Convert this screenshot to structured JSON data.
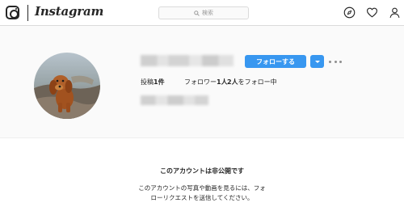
{
  "header": {
    "brand": "Instagram",
    "search_placeholder": "検索",
    "icons": [
      "instagram-glyph-icon",
      "search-icon",
      "explore-compass-icon",
      "heart-icon",
      "profile-icon"
    ]
  },
  "profile": {
    "follow_label": "フォローする",
    "stats": {
      "posts_label": "投稿",
      "posts_count": "1件",
      "followers_label": "フォロワー",
      "followers_count": "1人",
      "following_count": "2人",
      "following_label": "をフォロー中"
    }
  },
  "private_notice": {
    "title": "このアカウントは非公開です",
    "description": "このアカウントの写真や動画を見るには、フォローリクエストを送信してください。"
  },
  "colors": {
    "accent": "#3897f0",
    "background": "#fafafa",
    "border": "#dbdbdb",
    "text": "#262626"
  }
}
